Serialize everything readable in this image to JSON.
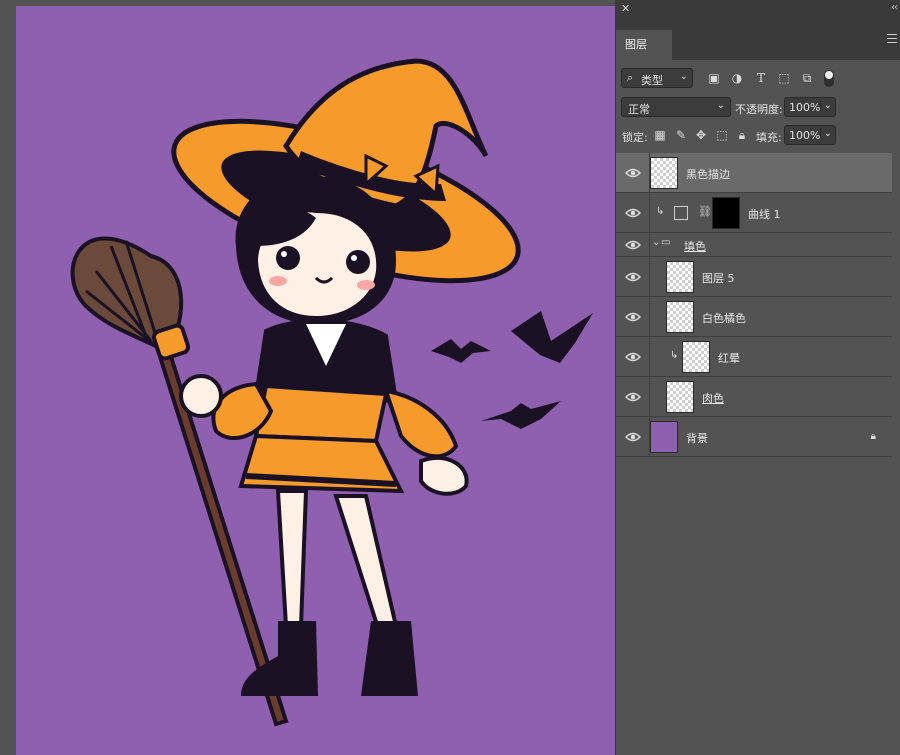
{
  "canvas": {
    "background_color": "#8f5fb0"
  },
  "panel": {
    "tab_label": "图层",
    "filter": {
      "label": "类型",
      "icons": [
        "image-filter-icon",
        "adjustment-filter-icon",
        "type-filter-icon",
        "shape-filter-icon",
        "smart-object-filter-icon"
      ]
    },
    "blend_mode": "正常",
    "opacity_label": "不透明度:",
    "opacity_value": "100%",
    "lock_label": "锁定:",
    "fill_label": "填充:",
    "fill_value": "100%"
  },
  "layers": [
    {
      "name": "黑色描边",
      "selected": true,
      "thumb": "lineart"
    },
    {
      "name": "曲线 1",
      "clipped": true,
      "adjustment": true
    },
    {
      "name": "填色",
      "group": true
    },
    {
      "name": "图层 5",
      "indent": true
    },
    {
      "name": "白色橘色",
      "indent": true
    },
    {
      "name": "红晕",
      "clipped": true,
      "indent": true
    },
    {
      "name": "肉色",
      "indent": true
    },
    {
      "name": "背景",
      "thumb": "purple",
      "locked": true
    }
  ]
}
